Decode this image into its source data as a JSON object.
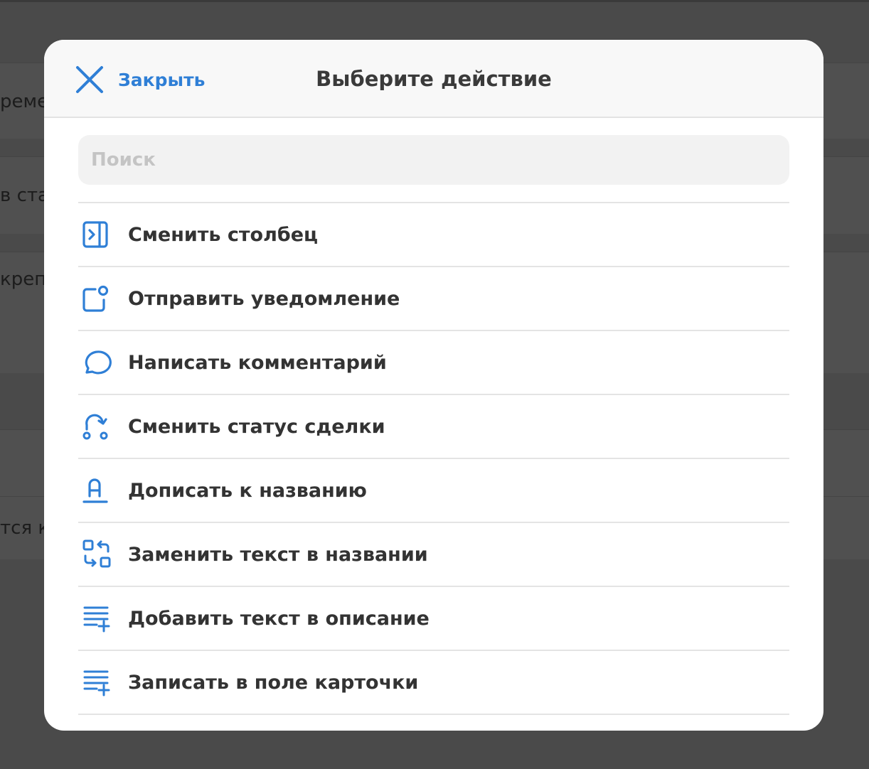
{
  "background": {
    "snippets": [
      "реме",
      "в ста",
      "крепл",
      "тся к"
    ]
  },
  "modal": {
    "close_label": "Закрыть",
    "title": "Выберите действие",
    "search_placeholder": "Поиск",
    "search_value": "",
    "actions": [
      {
        "label": "Сменить столбец",
        "icon": "move-to-column-icon"
      },
      {
        "label": "Отправить уведомление",
        "icon": "notification-icon"
      },
      {
        "label": "Написать комментарий",
        "icon": "comment-bubble-icon"
      },
      {
        "label": "Сменить статус сделки",
        "icon": "status-change-icon"
      },
      {
        "label": "Дописать к названию",
        "icon": "append-title-icon"
      },
      {
        "label": "Заменить текст в названии",
        "icon": "replace-text-icon"
      },
      {
        "label": "Добавить текст в описание",
        "icon": "add-description-icon"
      },
      {
        "label": "Записать в поле карточки",
        "icon": "write-field-icon"
      }
    ]
  },
  "colors": {
    "accent": "#2f7fd6",
    "overlay": "#4a4a4a",
    "text": "#333333"
  }
}
